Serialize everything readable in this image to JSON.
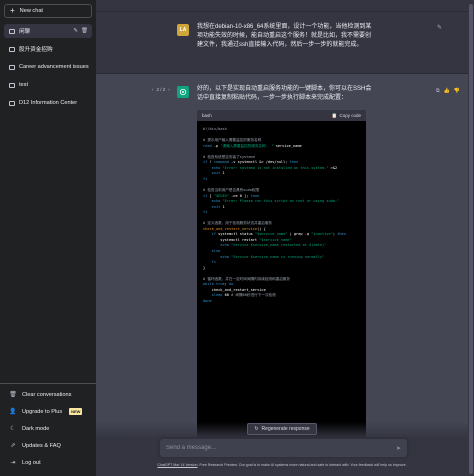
{
  "sidebar": {
    "new_chat": "New chat",
    "chats": [
      {
        "label": "闲聊",
        "active": true
      },
      {
        "label": "股升资金招购"
      },
      {
        "label": "Career advancement issues"
      },
      {
        "label": "test"
      },
      {
        "label": "D12 Information Center"
      }
    ],
    "bottom": {
      "clear": "Clear conversations",
      "upgrade": "Upgrade to Plus",
      "upgrade_badge": "NEW",
      "dark_mode": "Dark mode",
      "updates": "Updates & FAQ",
      "logout": "Log out"
    }
  },
  "conversation": {
    "user_avatar": "LA",
    "user_message": "我想在debian-10-x86_64系统里面，设计一个功能，当他检测到某项功能失效的时候，能自动重启这个服务！就是比如，我不需要创建文件，我通过ssh直接输入代码，然后一步一步的就能完成。",
    "pager": "2 / 2",
    "bot_message": "好的，以下是实现自动重启服务功能的一键脚本，你可以在SSH会话中直接复制粘贴代码，一步一步执行脚本来完成配置：",
    "code_lang": "bash",
    "copy_label": "Copy code"
  },
  "code_lines": [
    {
      "parts": [
        {
          "t": "#!/bin/bash",
          "c": "c-com"
        }
      ]
    },
    {
      "parts": [
        {
          "t": "",
          "c": ""
        }
      ]
    },
    {
      "parts": [
        {
          "t": "# 提示用户输入需要监控的服务名称",
          "c": "c-com"
        }
      ]
    },
    {
      "parts": [
        {
          "t": "read",
          "c": "c-kw"
        },
        {
          "t": " -p ",
          "c": ""
        },
        {
          "t": "\"请输入需要监控的服务名称： \"",
          "c": "c-str"
        },
        {
          "t": " service_name",
          "c": ""
        }
      ]
    },
    {
      "parts": [
        {
          "t": "",
          "c": ""
        }
      ]
    },
    {
      "parts": [
        {
          "t": "# 检查系统是否安装了systemd",
          "c": "c-com"
        }
      ]
    },
    {
      "parts": [
        {
          "t": "if",
          "c": "c-kw"
        },
        {
          "t": " ! ",
          "c": ""
        },
        {
          "t": "command",
          "c": "c-kw"
        },
        {
          "t": " -v systemctl &> /dev/null; ",
          "c": ""
        },
        {
          "t": "then",
          "c": "c-kw"
        }
      ]
    },
    {
      "parts": [
        {
          "t": "    ",
          "c": ""
        },
        {
          "t": "echo",
          "c": "c-kw"
        },
        {
          "t": " ",
          "c": ""
        },
        {
          "t": "\"Error: systemd is not installed on this system.\"",
          "c": "c-str"
        },
        {
          "t": " >&2",
          "c": ""
        }
      ]
    },
    {
      "parts": [
        {
          "t": "    ",
          "c": ""
        },
        {
          "t": "exit",
          "c": "c-kw"
        },
        {
          "t": " 1",
          "c": ""
        }
      ]
    },
    {
      "parts": [
        {
          "t": "fi",
          "c": "c-kw"
        }
      ]
    },
    {
      "parts": [
        {
          "t": "",
          "c": ""
        }
      ]
    },
    {
      "parts": [
        {
          "t": "# 检查当前用户是否具有sudo权限",
          "c": "c-com"
        }
      ]
    },
    {
      "parts": [
        {
          "t": "if",
          "c": "c-kw"
        },
        {
          "t": " [ ",
          "c": ""
        },
        {
          "t": "\"$EUID\"",
          "c": "c-str"
        },
        {
          "t": " -ne 0 ]; ",
          "c": ""
        },
        {
          "t": "then",
          "c": "c-kw"
        }
      ]
    },
    {
      "parts": [
        {
          "t": "    ",
          "c": ""
        },
        {
          "t": "echo",
          "c": "c-kw"
        },
        {
          "t": " ",
          "c": ""
        },
        {
          "t": "\"Error: Please run this script as root or using sudo.\"",
          "c": "c-str"
        }
      ]
    },
    {
      "parts": [
        {
          "t": "    ",
          "c": ""
        },
        {
          "t": "exit",
          "c": "c-kw"
        },
        {
          "t": " 1",
          "c": ""
        }
      ]
    },
    {
      "parts": [
        {
          "t": "fi",
          "c": "c-kw"
        }
      ]
    },
    {
      "parts": [
        {
          "t": "",
          "c": ""
        }
      ]
    },
    {
      "parts": [
        {
          "t": "# 定义函数，用于检测服务状态并重启服务",
          "c": "c-com"
        }
      ]
    },
    {
      "parts": [
        {
          "t": "check_and_restart_service",
          "c": "c-fn"
        },
        {
          "t": "() {",
          "c": ""
        }
      ]
    },
    {
      "parts": [
        {
          "t": "    ",
          "c": ""
        },
        {
          "t": "if",
          "c": "c-kw"
        },
        {
          "t": " systemctl status ",
          "c": ""
        },
        {
          "t": "\"$service_name\"",
          "c": "c-str"
        },
        {
          "t": " | grep -q ",
          "c": ""
        },
        {
          "t": "\"inactive\"",
          "c": "c-str"
        },
        {
          "t": "; ",
          "c": ""
        },
        {
          "t": "then",
          "c": "c-kw"
        }
      ]
    },
    {
      "parts": [
        {
          "t": "        systemctl restart ",
          "c": ""
        },
        {
          "t": "\"$service_name\"",
          "c": "c-str"
        }
      ]
    },
    {
      "parts": [
        {
          "t": "        ",
          "c": ""
        },
        {
          "t": "echo",
          "c": "c-kw"
        },
        {
          "t": " ",
          "c": ""
        },
        {
          "t": "\"Service $service_name restarted at $(date)\"",
          "c": "c-str"
        }
      ]
    },
    {
      "parts": [
        {
          "t": "    ",
          "c": ""
        },
        {
          "t": "else",
          "c": "c-kw"
        }
      ]
    },
    {
      "parts": [
        {
          "t": "        ",
          "c": ""
        },
        {
          "t": "echo",
          "c": "c-kw"
        },
        {
          "t": " ",
          "c": ""
        },
        {
          "t": "\"Service $service_name is running normally\"",
          "c": "c-str"
        }
      ]
    },
    {
      "parts": [
        {
          "t": "    ",
          "c": ""
        },
        {
          "t": "fi",
          "c": "c-kw"
        }
      ]
    },
    {
      "parts": [
        {
          "t": "}",
          "c": ""
        }
      ]
    },
    {
      "parts": [
        {
          "t": "",
          "c": ""
        }
      ]
    },
    {
      "parts": [
        {
          "t": "# 循环函数，并在一定时间间隔内持续检测和重启服务",
          "c": "c-com"
        }
      ]
    },
    {
      "parts": [
        {
          "t": "while",
          "c": "c-kw"
        },
        {
          "t": " ",
          "c": ""
        },
        {
          "t": "true",
          "c": "c-kw"
        },
        {
          "t": "; ",
          "c": ""
        },
        {
          "t": "do",
          "c": "c-kw"
        }
      ]
    },
    {
      "parts": [
        {
          "t": "    check_and_restart_service",
          "c": ""
        }
      ]
    },
    {
      "parts": [
        {
          "t": "    ",
          "c": ""
        },
        {
          "t": "sleep",
          "c": "c-kw"
        },
        {
          "t": " 60 ",
          "c": ""
        },
        {
          "t": "# 间隔60秒进行下一次检测",
          "c": "c-com"
        }
      ]
    },
    {
      "parts": [
        {
          "t": "done",
          "c": "c-kw"
        }
      ]
    }
  ],
  "bottom": {
    "regenerate": "Regenerate response",
    "input_placeholder": "Send a message...",
    "footer_link": "ChatGPT Mar 14 Version",
    "footer_text": ". Free Research Preview. Our goal is to make AI systems more natural and safe to interact with. Your feedback will help us improve."
  }
}
